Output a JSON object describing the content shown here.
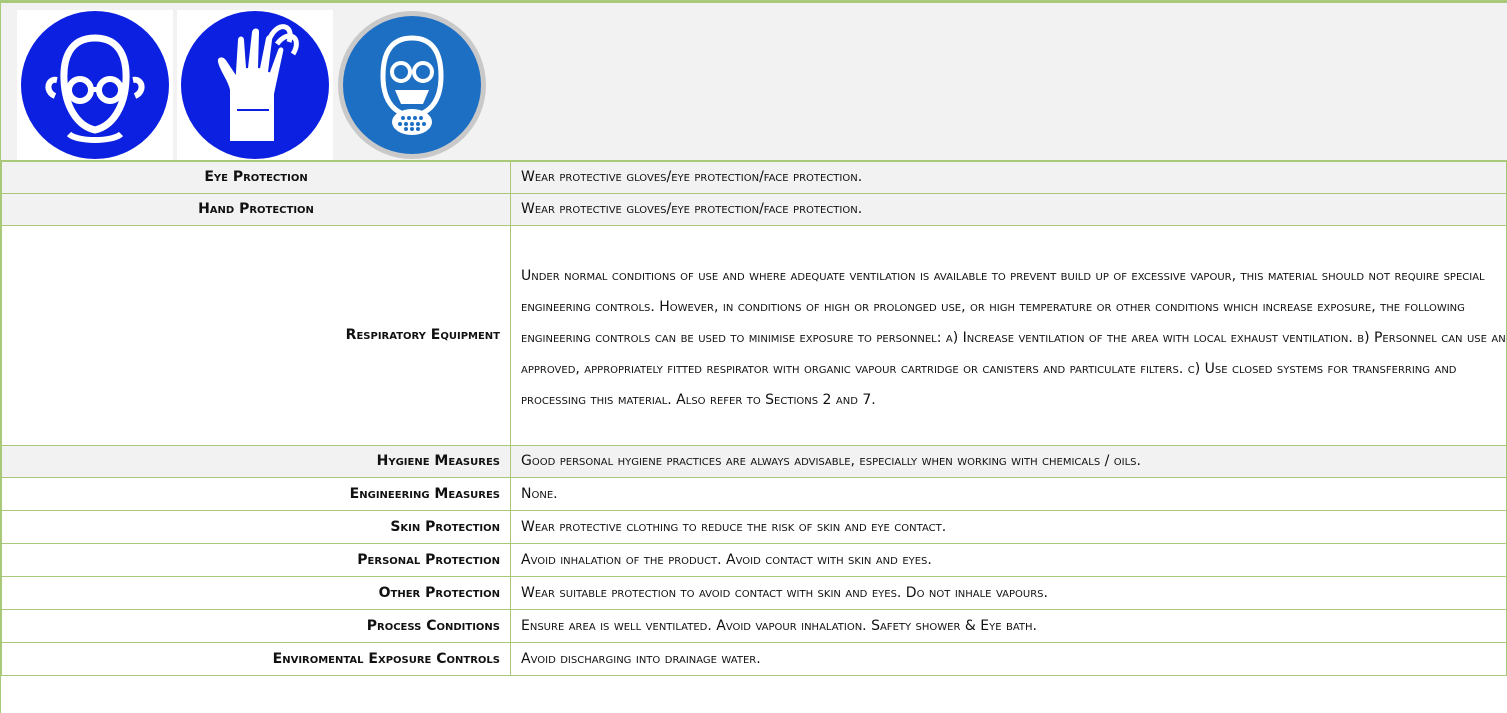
{
  "icons": [
    {
      "name": "eye-protection-icon",
      "color": "#0b20e0"
    },
    {
      "name": "hand-protection-icon",
      "color": "#0b20e0"
    },
    {
      "name": "respirator-mask-icon",
      "color": "#1d6fc4"
    }
  ],
  "colors": {
    "border": "#a8c97a",
    "shade": "#f2f2f2"
  },
  "rows": [
    {
      "label": "Eye Protection",
      "value": "Wear protective gloves/eye protection/face protection."
    },
    {
      "label": "Hand Protection",
      "value": "Wear protective gloves/eye protection/face protection."
    },
    {
      "label": "Respiratory Equipment",
      "value": "Under normal conditions of use and where adequate ventilation is available to prevent build up of excessive vapour, this material should not require special engineering controls. However, in conditions of high or prolonged use, or high temperature or other conditions which increase exposure, the following engineering controls can be used to minimise exposure to personnel: a) Increase ventilation of the area with local exhaust ventilation. b) Personnel can use an approved, appropriately fitted respirator with organic vapour cartridge or canisters and particulate filters. c) Use closed systems for transferring and processing this material. Also refer to Sections 2 and 7."
    },
    {
      "label": "Hygiene Measures",
      "value": "Good personal hygiene practices are always advisable, especially when working with chemicals / oils."
    },
    {
      "label": "Engineering Measures",
      "value": "None."
    },
    {
      "label": "Skin Protection",
      "value": "Wear protective clothing to reduce the risk of skin and eye contact."
    },
    {
      "label": "Personal Protection",
      "value": "Avoid inhalation of the product. Avoid contact with skin and eyes."
    },
    {
      "label": "Other Protection",
      "value": "Wear suitable protection to avoid contact with skin and eyes. Do not inhale vapours."
    },
    {
      "label": "Process Conditions",
      "value": "Ensure area is well ventilated. Avoid vapour inhalation. Safety shower & Eye bath."
    },
    {
      "label": "Enviromental Exposure Controls",
      "value": "Avoid discharging into drainage water."
    }
  ]
}
